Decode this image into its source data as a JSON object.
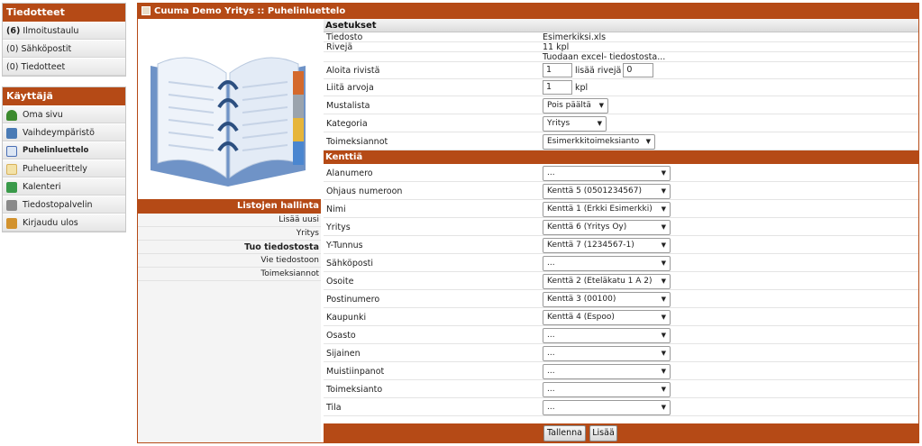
{
  "sidebar": {
    "news": {
      "title": "Tiedotteet",
      "items": [
        {
          "count": "(6)",
          "label": "Ilmoitustaulu"
        },
        {
          "count": "(0)",
          "label": "Sähköpostit"
        },
        {
          "count": "(0)",
          "label": "Tiedotteet"
        }
      ]
    },
    "user": {
      "title": "Käyttäjä",
      "items": [
        {
          "label": "Oma sivu",
          "icon": "person-icon",
          "color": "#3c8a2e"
        },
        {
          "label": "Vaihdeympäristö",
          "icon": "switchboard-icon",
          "color": "#4a7bb5"
        },
        {
          "label": "Puhelinluettelo",
          "icon": "phonebook-icon",
          "color": "#4a6fb5",
          "active": true
        },
        {
          "label": "Puhelueerittely",
          "icon": "document-icon",
          "color": "#d8b25a"
        },
        {
          "label": "Kalenteri",
          "icon": "calendar-icon",
          "color": "#3a9a4a"
        },
        {
          "label": "Tiedostopalvelin",
          "icon": "file-server-icon",
          "color": "#8a8a8a"
        },
        {
          "label": "Kirjaudu ulos",
          "icon": "logout-icon",
          "color": "#d2922e"
        }
      ]
    }
  },
  "main": {
    "title": "Cuuma Demo Yritys :: Puhelinluettelo",
    "menu": {
      "title": "Listojen hallinta",
      "items": [
        {
          "label": "Lisää uusi"
        },
        {
          "label": "Yritys"
        },
        {
          "label": "Tuo tiedostosta",
          "active": true
        },
        {
          "label": "Vie tiedostoon"
        },
        {
          "label": "Toimeksiannot"
        }
      ]
    },
    "settings": {
      "title": "Asetukset",
      "file_label": "Tiedosto",
      "file_value": "Esimerkiksi.xls",
      "rows_label": "Rivejä",
      "rows_value": "11 kpl",
      "importing_text": "Tuodaan excel- tiedostosta...",
      "start_row_label": "Aloita rivistä",
      "start_row_value": "1",
      "add_rows_label": "lisää rivejä",
      "add_rows_value": "0",
      "attach_label": "Liitä arvoja",
      "attach_value": "1",
      "attach_unit": "kpl",
      "blacklist_label": "Mustalista",
      "blacklist_value": "Pois päältä",
      "category_label": "Kategoria",
      "category_value": "Yritys",
      "assignments_label": "Toimeksiannot",
      "assignments_value": "Esimerkkitoimeksianto"
    },
    "fields": {
      "title": "Kenttiä",
      "rows": [
        {
          "label": "Alanumero",
          "value": "..."
        },
        {
          "label": "Ohjaus numeroon",
          "value": "Kenttä 5 (0501234567)"
        },
        {
          "label": "Nimi",
          "value": "Kenttä 1 (Erkki Esimerkki)"
        },
        {
          "label": "Yritys",
          "value": "Kenttä 6 (Yritys Oy)"
        },
        {
          "label": "Y-Tunnus",
          "value": "Kenttä 7 (1234567-1)"
        },
        {
          "label": "Sähköposti",
          "value": "..."
        },
        {
          "label": "Osoite",
          "value": "Kenttä 2 (Eteläkatu 1 A 2)"
        },
        {
          "label": "Postinumero",
          "value": "Kenttä 3 (00100)"
        },
        {
          "label": "Kaupunki",
          "value": "Kenttä 4 (Espoo)"
        },
        {
          "label": "Osasto",
          "value": "..."
        },
        {
          "label": "Sijainen",
          "value": "..."
        },
        {
          "label": "Muistiinpanot",
          "value": "..."
        },
        {
          "label": "Toimeksianto",
          "value": "..."
        },
        {
          "label": "Tila",
          "value": "..."
        }
      ]
    },
    "buttons": {
      "save_label": "Tallenna",
      "add_label": "Lisää"
    }
  },
  "colors": {
    "accent": "#b54a16"
  }
}
